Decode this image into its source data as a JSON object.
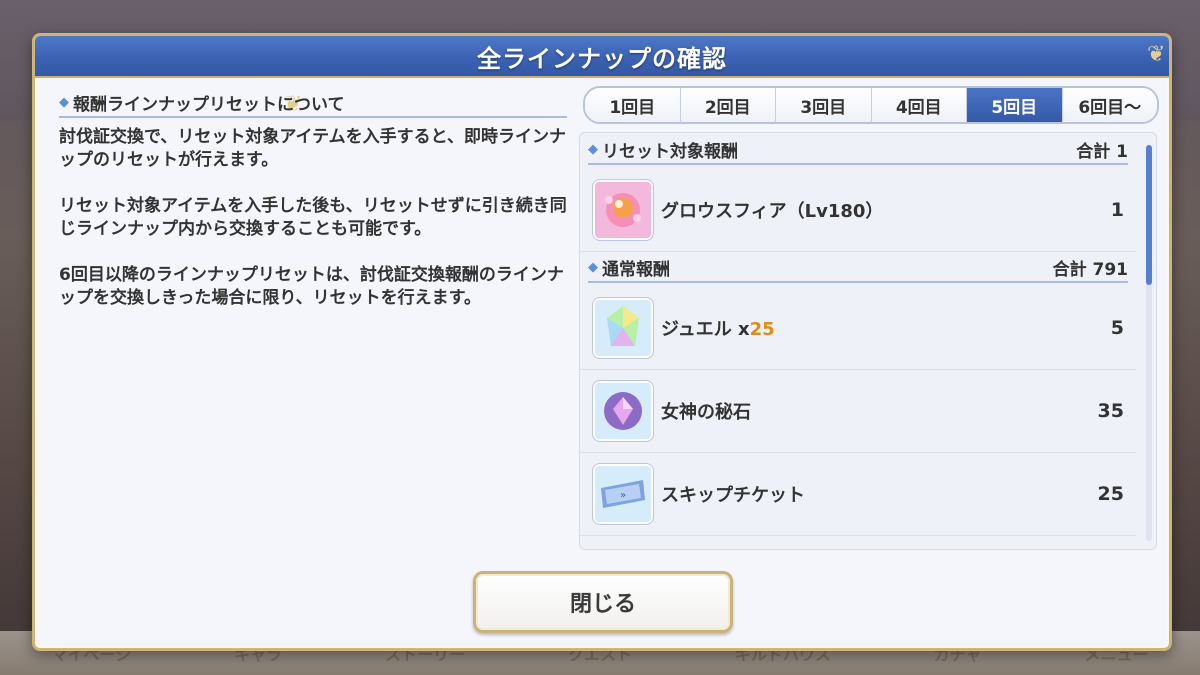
{
  "background": {
    "nav": [
      "マイページ",
      "キャラ",
      "ストーリー",
      "クエスト",
      "ギルドハウス",
      "ガチャ",
      "メニュー"
    ]
  },
  "dialog": {
    "title": "全ラインナップの確認",
    "info": {
      "heading": "報酬ラインナップリセットについて",
      "paragraphs": [
        "討伐証交換で、リセット対象アイテムを入手すると、即時ラインナップのリセットが行えます。",
        "リセット対象アイテムを入手した後も、リセットせずに引き続き同じラインナップ内から交換することも可能です。",
        "6回目以降のラインナップリセットは、討伐証交換報酬のラインナップを交換しきった場合に限り、リセットを行えます。"
      ]
    },
    "tabs": [
      "1回目",
      "2回目",
      "3回目",
      "4回目",
      "5回目",
      "6回目〜"
    ],
    "active_tab": "5回目",
    "reset_section": {
      "label": "リセット対象報酬",
      "total": "合計 1",
      "items": [
        {
          "name": "グロウスフィア（Lv180）",
          "count": "1",
          "icon": "growth-sphere-icon"
        }
      ]
    },
    "normal_section": {
      "label": "通常報酬",
      "total": "合計 791",
      "items": [
        {
          "name": "ジュエル x",
          "multiplier": "25",
          "count": "5",
          "icon": "jewel-icon"
        },
        {
          "name": "女神の秘石",
          "count": "35",
          "icon": "goddess-stone-icon"
        },
        {
          "name": "スキップチケット",
          "count": "25",
          "icon": "skip-ticket-icon"
        }
      ]
    },
    "close_label": "閉じる"
  },
  "colors": {
    "header_blue": "#3b62b3",
    "tab_active": "#3459a8",
    "gold_border": "#cdb57a",
    "multiplier": "#e18b16"
  }
}
